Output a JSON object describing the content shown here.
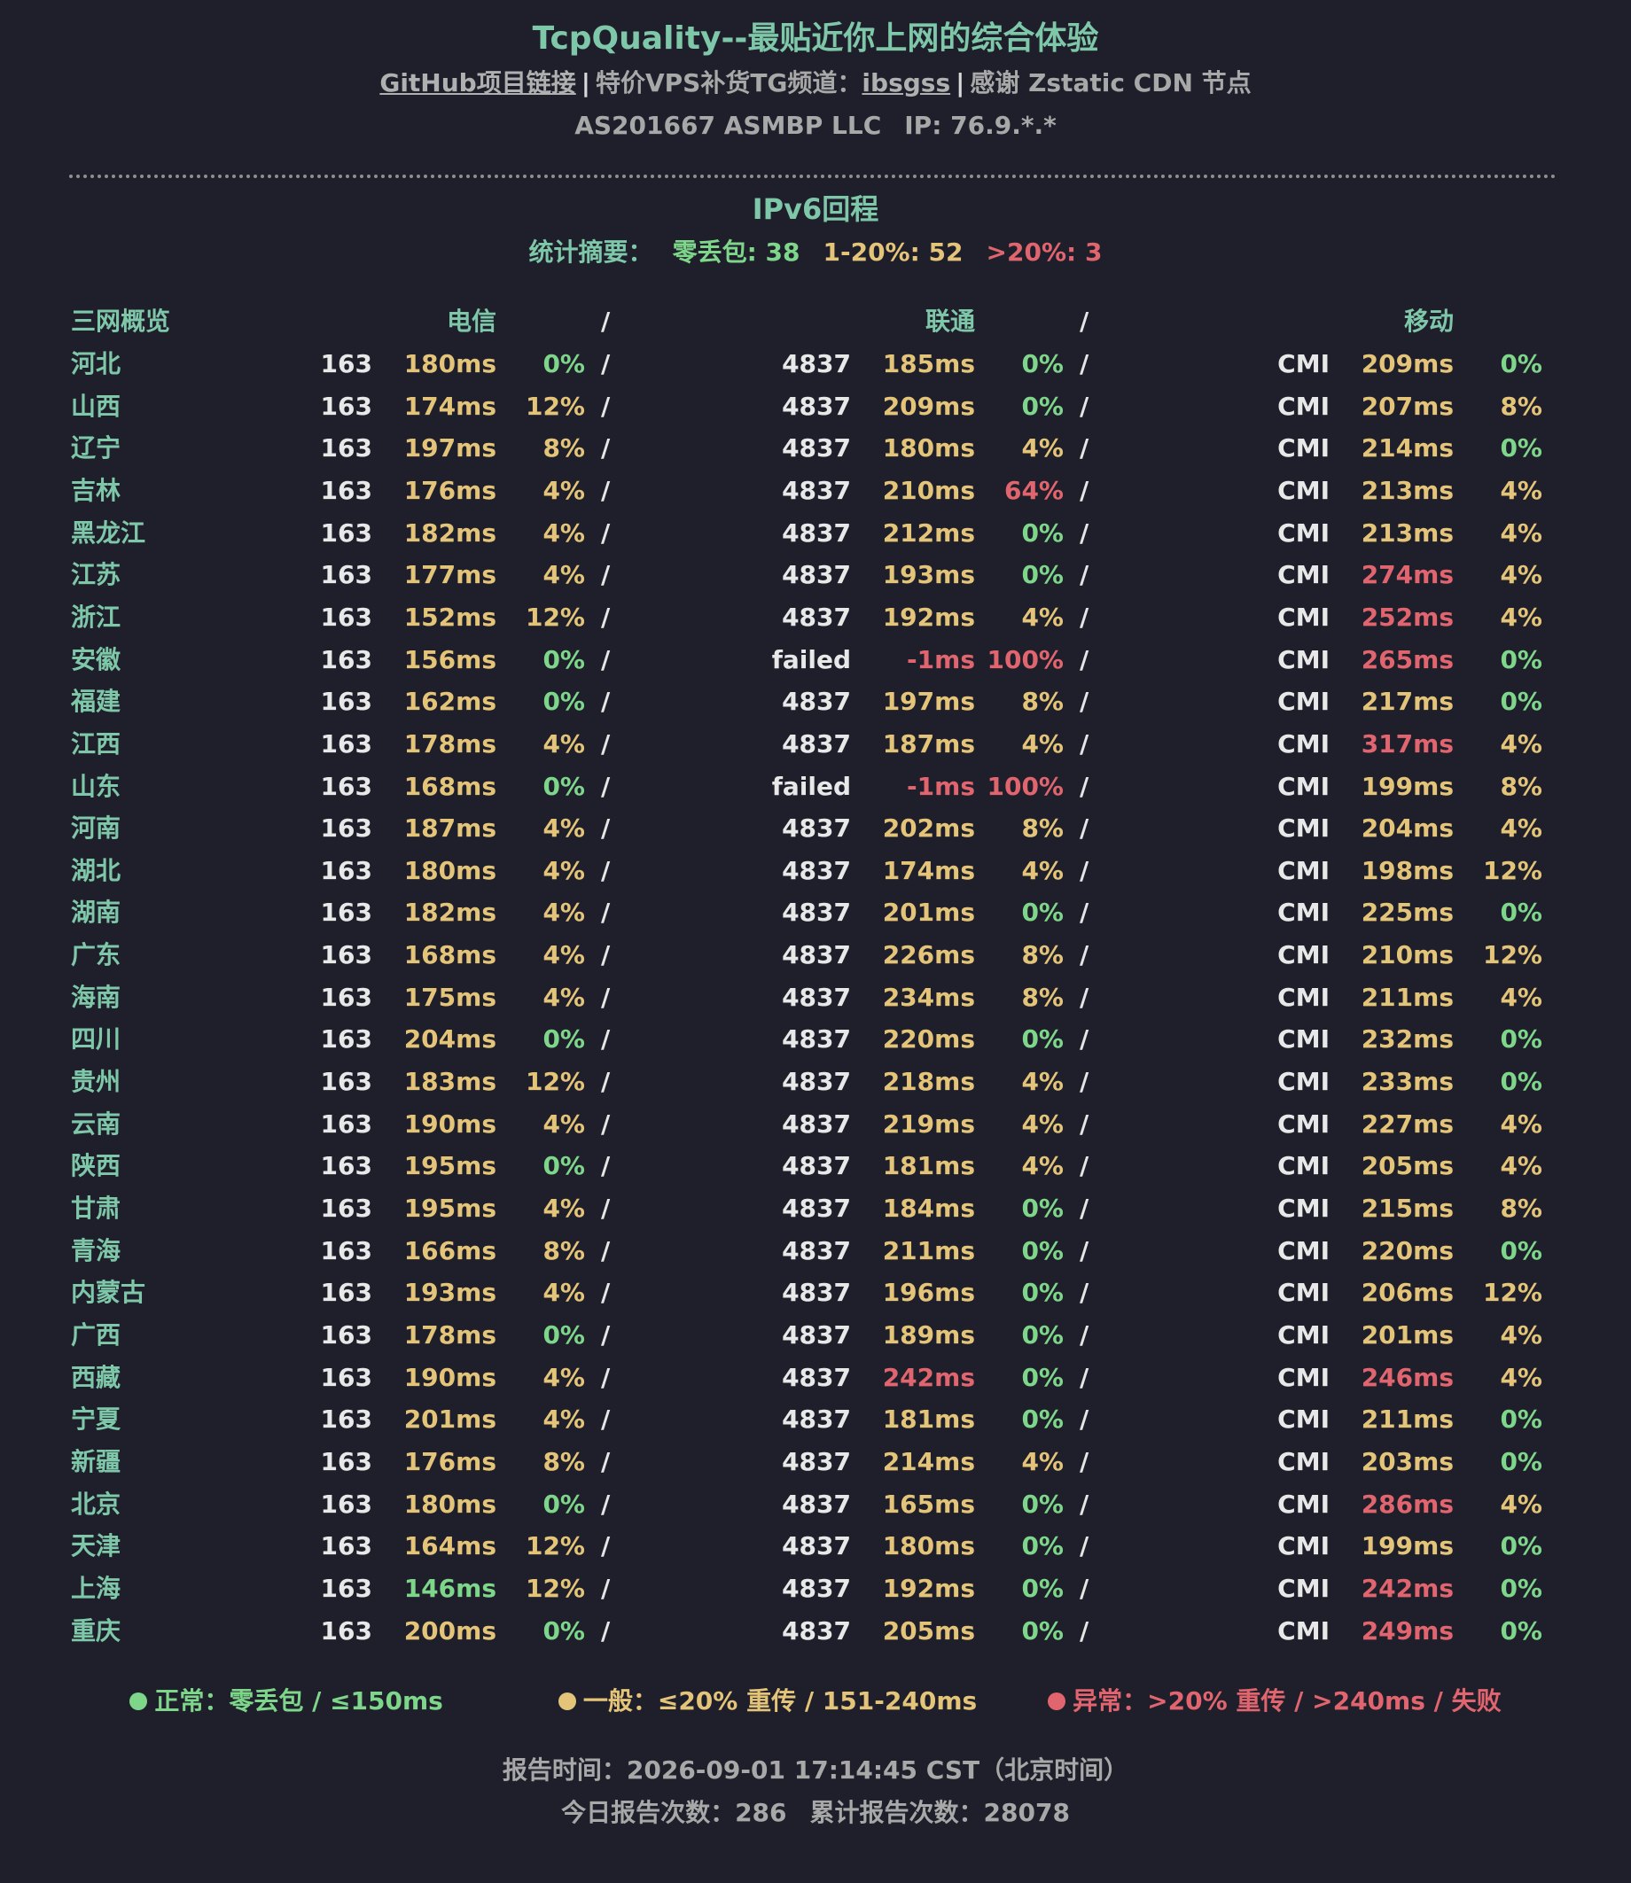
{
  "header": {
    "title": "TcpQuality--最贴近你上网的综合体验",
    "github_link": "GitHub项目链接",
    "separator": "|",
    "vps_prefix": "特价VPS补货TG频道：",
    "vps_channel": "ibsgss",
    "cdn_text": "感谢 Zstatic CDN 节点",
    "asn": "AS201667 ASMBP LLC",
    "ip": "IP: 76.9.*.*"
  },
  "section": {
    "title": "IPv6回程",
    "summary_label": "统计摘要：",
    "summary_good": "零丢包: 38",
    "summary_mid": "1-20%: 52",
    "summary_bad": ">20%: 3"
  },
  "table": {
    "header": {
      "overview": "三网概览",
      "telecom": "电信",
      "unicom": "联通",
      "mobile": "移动",
      "slash": "/"
    },
    "rows": [
      {
        "province": "河北",
        "t_asn": "163",
        "t_lat": "180ms",
        "t_lat_s": "mid",
        "t_loss": "0%",
        "t_loss_s": "good",
        "u_asn": "4837",
        "u_lat": "185ms",
        "u_lat_s": "mid",
        "u_loss": "0%",
        "u_loss_s": "good",
        "m_asn": "CMI",
        "m_lat": "209ms",
        "m_lat_s": "mid",
        "m_loss": "0%",
        "m_loss_s": "good"
      },
      {
        "province": "山西",
        "t_asn": "163",
        "t_lat": "174ms",
        "t_lat_s": "mid",
        "t_loss": "12%",
        "t_loss_s": "mid",
        "u_asn": "4837",
        "u_lat": "209ms",
        "u_lat_s": "mid",
        "u_loss": "0%",
        "u_loss_s": "good",
        "m_asn": "CMI",
        "m_lat": "207ms",
        "m_lat_s": "mid",
        "m_loss": "8%",
        "m_loss_s": "mid"
      },
      {
        "province": "辽宁",
        "t_asn": "163",
        "t_lat": "197ms",
        "t_lat_s": "mid",
        "t_loss": "8%",
        "t_loss_s": "mid",
        "u_asn": "4837",
        "u_lat": "180ms",
        "u_lat_s": "mid",
        "u_loss": "4%",
        "u_loss_s": "mid",
        "m_asn": "CMI",
        "m_lat": "214ms",
        "m_lat_s": "mid",
        "m_loss": "0%",
        "m_loss_s": "good"
      },
      {
        "province": "吉林",
        "t_asn": "163",
        "t_lat": "176ms",
        "t_lat_s": "mid",
        "t_loss": "4%",
        "t_loss_s": "mid",
        "u_asn": "4837",
        "u_lat": "210ms",
        "u_lat_s": "mid",
        "u_loss": "64%",
        "u_loss_s": "bad",
        "m_asn": "CMI",
        "m_lat": "213ms",
        "m_lat_s": "mid",
        "m_loss": "4%",
        "m_loss_s": "mid"
      },
      {
        "province": "黑龙江",
        "t_asn": "163",
        "t_lat": "182ms",
        "t_lat_s": "mid",
        "t_loss": "4%",
        "t_loss_s": "mid",
        "u_asn": "4837",
        "u_lat": "212ms",
        "u_lat_s": "mid",
        "u_loss": "0%",
        "u_loss_s": "good",
        "m_asn": "CMI",
        "m_lat": "213ms",
        "m_lat_s": "mid",
        "m_loss": "4%",
        "m_loss_s": "mid"
      },
      {
        "province": "江苏",
        "t_asn": "163",
        "t_lat": "177ms",
        "t_lat_s": "mid",
        "t_loss": "4%",
        "t_loss_s": "mid",
        "u_asn": "4837",
        "u_lat": "193ms",
        "u_lat_s": "mid",
        "u_loss": "0%",
        "u_loss_s": "good",
        "m_asn": "CMI",
        "m_lat": "274ms",
        "m_lat_s": "bad",
        "m_loss": "4%",
        "m_loss_s": "mid"
      },
      {
        "province": "浙江",
        "t_asn": "163",
        "t_lat": "152ms",
        "t_lat_s": "mid",
        "t_loss": "12%",
        "t_loss_s": "mid",
        "u_asn": "4837",
        "u_lat": "192ms",
        "u_lat_s": "mid",
        "u_loss": "4%",
        "u_loss_s": "mid",
        "m_asn": "CMI",
        "m_lat": "252ms",
        "m_lat_s": "bad",
        "m_loss": "4%",
        "m_loss_s": "mid"
      },
      {
        "province": "安徽",
        "t_asn": "163",
        "t_lat": "156ms",
        "t_lat_s": "mid",
        "t_loss": "0%",
        "t_loss_s": "good",
        "u_asn": "failed",
        "u_lat": "-1ms",
        "u_lat_s": "bad",
        "u_loss": "100%",
        "u_loss_s": "bad",
        "m_asn": "CMI",
        "m_lat": "265ms",
        "m_lat_s": "bad",
        "m_loss": "0%",
        "m_loss_s": "good"
      },
      {
        "province": "福建",
        "t_asn": "163",
        "t_lat": "162ms",
        "t_lat_s": "mid",
        "t_loss": "0%",
        "t_loss_s": "good",
        "u_asn": "4837",
        "u_lat": "197ms",
        "u_lat_s": "mid",
        "u_loss": "8%",
        "u_loss_s": "mid",
        "m_asn": "CMI",
        "m_lat": "217ms",
        "m_lat_s": "mid",
        "m_loss": "0%",
        "m_loss_s": "good"
      },
      {
        "province": "江西",
        "t_asn": "163",
        "t_lat": "178ms",
        "t_lat_s": "mid",
        "t_loss": "4%",
        "t_loss_s": "mid",
        "u_asn": "4837",
        "u_lat": "187ms",
        "u_lat_s": "mid",
        "u_loss": "4%",
        "u_loss_s": "mid",
        "m_asn": "CMI",
        "m_lat": "317ms",
        "m_lat_s": "bad",
        "m_loss": "4%",
        "m_loss_s": "mid"
      },
      {
        "province": "山东",
        "t_asn": "163",
        "t_lat": "168ms",
        "t_lat_s": "mid",
        "t_loss": "0%",
        "t_loss_s": "good",
        "u_asn": "failed",
        "u_lat": "-1ms",
        "u_lat_s": "bad",
        "u_loss": "100%",
        "u_loss_s": "bad",
        "m_asn": "CMI",
        "m_lat": "199ms",
        "m_lat_s": "mid",
        "m_loss": "8%",
        "m_loss_s": "mid"
      },
      {
        "province": "河南",
        "t_asn": "163",
        "t_lat": "187ms",
        "t_lat_s": "mid",
        "t_loss": "4%",
        "t_loss_s": "mid",
        "u_asn": "4837",
        "u_lat": "202ms",
        "u_lat_s": "mid",
        "u_loss": "8%",
        "u_loss_s": "mid",
        "m_asn": "CMI",
        "m_lat": "204ms",
        "m_lat_s": "mid",
        "m_loss": "4%",
        "m_loss_s": "mid"
      },
      {
        "province": "湖北",
        "t_asn": "163",
        "t_lat": "180ms",
        "t_lat_s": "mid",
        "t_loss": "4%",
        "t_loss_s": "mid",
        "u_asn": "4837",
        "u_lat": "174ms",
        "u_lat_s": "mid",
        "u_loss": "4%",
        "u_loss_s": "mid",
        "m_asn": "CMI",
        "m_lat": "198ms",
        "m_lat_s": "mid",
        "m_loss": "12%",
        "m_loss_s": "mid"
      },
      {
        "province": "湖南",
        "t_asn": "163",
        "t_lat": "182ms",
        "t_lat_s": "mid",
        "t_loss": "4%",
        "t_loss_s": "mid",
        "u_asn": "4837",
        "u_lat": "201ms",
        "u_lat_s": "mid",
        "u_loss": "0%",
        "u_loss_s": "good",
        "m_asn": "CMI",
        "m_lat": "225ms",
        "m_lat_s": "mid",
        "m_loss": "0%",
        "m_loss_s": "good"
      },
      {
        "province": "广东",
        "t_asn": "163",
        "t_lat": "168ms",
        "t_lat_s": "mid",
        "t_loss": "4%",
        "t_loss_s": "mid",
        "u_asn": "4837",
        "u_lat": "226ms",
        "u_lat_s": "mid",
        "u_loss": "8%",
        "u_loss_s": "mid",
        "m_asn": "CMI",
        "m_lat": "210ms",
        "m_lat_s": "mid",
        "m_loss": "12%",
        "m_loss_s": "mid"
      },
      {
        "province": "海南",
        "t_asn": "163",
        "t_lat": "175ms",
        "t_lat_s": "mid",
        "t_loss": "4%",
        "t_loss_s": "mid",
        "u_asn": "4837",
        "u_lat": "234ms",
        "u_lat_s": "mid",
        "u_loss": "8%",
        "u_loss_s": "mid",
        "m_asn": "CMI",
        "m_lat": "211ms",
        "m_lat_s": "mid",
        "m_loss": "4%",
        "m_loss_s": "mid"
      },
      {
        "province": "四川",
        "t_asn": "163",
        "t_lat": "204ms",
        "t_lat_s": "mid",
        "t_loss": "0%",
        "t_loss_s": "good",
        "u_asn": "4837",
        "u_lat": "220ms",
        "u_lat_s": "mid",
        "u_loss": "0%",
        "u_loss_s": "good",
        "m_asn": "CMI",
        "m_lat": "232ms",
        "m_lat_s": "mid",
        "m_loss": "0%",
        "m_loss_s": "good"
      },
      {
        "province": "贵州",
        "t_asn": "163",
        "t_lat": "183ms",
        "t_lat_s": "mid",
        "t_loss": "12%",
        "t_loss_s": "mid",
        "u_asn": "4837",
        "u_lat": "218ms",
        "u_lat_s": "mid",
        "u_loss": "4%",
        "u_loss_s": "mid",
        "m_asn": "CMI",
        "m_lat": "233ms",
        "m_lat_s": "mid",
        "m_loss": "0%",
        "m_loss_s": "good"
      },
      {
        "province": "云南",
        "t_asn": "163",
        "t_lat": "190ms",
        "t_lat_s": "mid",
        "t_loss": "4%",
        "t_loss_s": "mid",
        "u_asn": "4837",
        "u_lat": "219ms",
        "u_lat_s": "mid",
        "u_loss": "4%",
        "u_loss_s": "mid",
        "m_asn": "CMI",
        "m_lat": "227ms",
        "m_lat_s": "mid",
        "m_loss": "4%",
        "m_loss_s": "mid"
      },
      {
        "province": "陕西",
        "t_asn": "163",
        "t_lat": "195ms",
        "t_lat_s": "mid",
        "t_loss": "0%",
        "t_loss_s": "good",
        "u_asn": "4837",
        "u_lat": "181ms",
        "u_lat_s": "mid",
        "u_loss": "4%",
        "u_loss_s": "mid",
        "m_asn": "CMI",
        "m_lat": "205ms",
        "m_lat_s": "mid",
        "m_loss": "4%",
        "m_loss_s": "mid"
      },
      {
        "province": "甘肃",
        "t_asn": "163",
        "t_lat": "195ms",
        "t_lat_s": "mid",
        "t_loss": "4%",
        "t_loss_s": "mid",
        "u_asn": "4837",
        "u_lat": "184ms",
        "u_lat_s": "mid",
        "u_loss": "0%",
        "u_loss_s": "good",
        "m_asn": "CMI",
        "m_lat": "215ms",
        "m_lat_s": "mid",
        "m_loss": "8%",
        "m_loss_s": "mid"
      },
      {
        "province": "青海",
        "t_asn": "163",
        "t_lat": "166ms",
        "t_lat_s": "mid",
        "t_loss": "8%",
        "t_loss_s": "mid",
        "u_asn": "4837",
        "u_lat": "211ms",
        "u_lat_s": "mid",
        "u_loss": "0%",
        "u_loss_s": "good",
        "m_asn": "CMI",
        "m_lat": "220ms",
        "m_lat_s": "mid",
        "m_loss": "0%",
        "m_loss_s": "good"
      },
      {
        "province": "内蒙古",
        "t_asn": "163",
        "t_lat": "193ms",
        "t_lat_s": "mid",
        "t_loss": "4%",
        "t_loss_s": "mid",
        "u_asn": "4837",
        "u_lat": "196ms",
        "u_lat_s": "mid",
        "u_loss": "0%",
        "u_loss_s": "good",
        "m_asn": "CMI",
        "m_lat": "206ms",
        "m_lat_s": "mid",
        "m_loss": "12%",
        "m_loss_s": "mid"
      },
      {
        "province": "广西",
        "t_asn": "163",
        "t_lat": "178ms",
        "t_lat_s": "mid",
        "t_loss": "0%",
        "t_loss_s": "good",
        "u_asn": "4837",
        "u_lat": "189ms",
        "u_lat_s": "mid",
        "u_loss": "0%",
        "u_loss_s": "good",
        "m_asn": "CMI",
        "m_lat": "201ms",
        "m_lat_s": "mid",
        "m_loss": "4%",
        "m_loss_s": "mid"
      },
      {
        "province": "西藏",
        "t_asn": "163",
        "t_lat": "190ms",
        "t_lat_s": "mid",
        "t_loss": "4%",
        "t_loss_s": "mid",
        "u_asn": "4837",
        "u_lat": "242ms",
        "u_lat_s": "bad",
        "u_loss": "0%",
        "u_loss_s": "good",
        "m_asn": "CMI",
        "m_lat": "246ms",
        "m_lat_s": "bad",
        "m_loss": "4%",
        "m_loss_s": "mid"
      },
      {
        "province": "宁夏",
        "t_asn": "163",
        "t_lat": "201ms",
        "t_lat_s": "mid",
        "t_loss": "4%",
        "t_loss_s": "mid",
        "u_asn": "4837",
        "u_lat": "181ms",
        "u_lat_s": "mid",
        "u_loss": "0%",
        "u_loss_s": "good",
        "m_asn": "CMI",
        "m_lat": "211ms",
        "m_lat_s": "mid",
        "m_loss": "0%",
        "m_loss_s": "good"
      },
      {
        "province": "新疆",
        "t_asn": "163",
        "t_lat": "176ms",
        "t_lat_s": "mid",
        "t_loss": "8%",
        "t_loss_s": "mid",
        "u_asn": "4837",
        "u_lat": "214ms",
        "u_lat_s": "mid",
        "u_loss": "4%",
        "u_loss_s": "mid",
        "m_asn": "CMI",
        "m_lat": "203ms",
        "m_lat_s": "mid",
        "m_loss": "0%",
        "m_loss_s": "good"
      },
      {
        "province": "北京",
        "t_asn": "163",
        "t_lat": "180ms",
        "t_lat_s": "mid",
        "t_loss": "0%",
        "t_loss_s": "good",
        "u_asn": "4837",
        "u_lat": "165ms",
        "u_lat_s": "mid",
        "u_loss": "0%",
        "u_loss_s": "good",
        "m_asn": "CMI",
        "m_lat": "286ms",
        "m_lat_s": "bad",
        "m_loss": "4%",
        "m_loss_s": "mid"
      },
      {
        "province": "天津",
        "t_asn": "163",
        "t_lat": "164ms",
        "t_lat_s": "mid",
        "t_loss": "12%",
        "t_loss_s": "mid",
        "u_asn": "4837",
        "u_lat": "180ms",
        "u_lat_s": "mid",
        "u_loss": "0%",
        "u_loss_s": "good",
        "m_asn": "CMI",
        "m_lat": "199ms",
        "m_lat_s": "mid",
        "m_loss": "0%",
        "m_loss_s": "good"
      },
      {
        "province": "上海",
        "t_asn": "163",
        "t_lat": "146ms",
        "t_lat_s": "good",
        "t_loss": "12%",
        "t_loss_s": "mid",
        "u_asn": "4837",
        "u_lat": "192ms",
        "u_lat_s": "mid",
        "u_loss": "0%",
        "u_loss_s": "good",
        "m_asn": "CMI",
        "m_lat": "242ms",
        "m_lat_s": "bad",
        "m_loss": "0%",
        "m_loss_s": "good"
      },
      {
        "province": "重庆",
        "t_asn": "163",
        "t_lat": "200ms",
        "t_lat_s": "mid",
        "t_loss": "0%",
        "t_loss_s": "good",
        "u_asn": "4837",
        "u_lat": "205ms",
        "u_lat_s": "mid",
        "u_loss": "0%",
        "u_loss_s": "good",
        "m_asn": "CMI",
        "m_lat": "249ms",
        "m_lat_s": "bad",
        "m_loss": "0%",
        "m_loss_s": "good"
      }
    ]
  },
  "legend": {
    "good": "正常：零丢包 / ≤150ms",
    "mid": "一般：≤20% 重传 / 151-240ms",
    "bad": "异常：>20% 重传 / >240ms / 失败"
  },
  "footer": {
    "report_time": "报告时间：2026-09-01 17:14:45 CST（北京时间）",
    "today_count": "今日报告次数：286",
    "total_count": "累计报告次数：28078"
  },
  "colors": {
    "background": "#1f1f2b",
    "accent": "#7ec7a8",
    "good": "#7ed68a",
    "mid": "#e3c479",
    "bad": "#e0656e"
  }
}
